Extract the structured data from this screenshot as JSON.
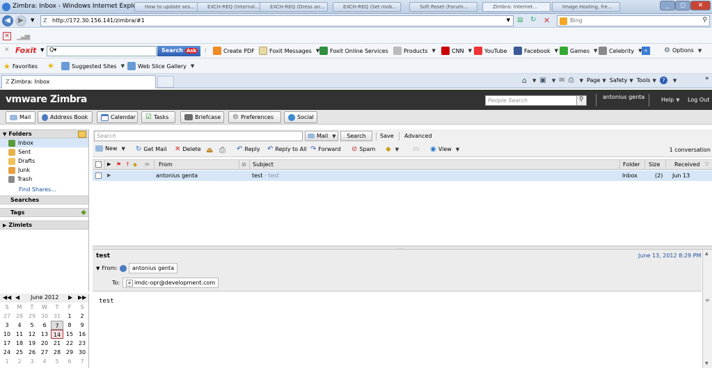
{
  "browser": {
    "window_title": "Zimbra: Inbox - Windows Internet Explorer",
    "taskbar_tabs": [
      "How to update ses...",
      "EXCH-REQ (Internal...",
      "EXCH-REQ (Dress an...",
      "EXCH-REQ (Set mob...",
      "Soft Reset (Forum...",
      "Zimbra: Internet...",
      "Image Hosting, fre..."
    ],
    "url": "http://172.30.156.141/zimbra/#1",
    "search_engine": "Bing",
    "foxit": {
      "brand": "Foxit",
      "search_button": "Search",
      "items": [
        "Create PDF",
        "Foxit Messages",
        "Foxit Online Services",
        "Products",
        "CNN",
        "YouTube",
        "Facebook",
        "Games",
        "Celebrity"
      ],
      "options": "Options"
    },
    "favorites": {
      "label": "Favorites",
      "suggested": "Suggested Sites",
      "webslice": "Web Slice Gallery"
    },
    "tab_title": "Zimbra: Inbox",
    "command_bar": {
      "page": "Page",
      "safety": "Safety",
      "tools": "Tools"
    }
  },
  "zimbra": {
    "logo": "vmware Zimbra",
    "people_search_placeholder": "People Search",
    "user": "antonius genta",
    "help": "Help",
    "logout": "Log Out",
    "apps": [
      "Mail",
      "Address Book",
      "Calendar",
      "Tasks",
      "Briefcase",
      "Preferences",
      "Social"
    ],
    "folders_header": "Folders",
    "folders": [
      "Inbox",
      "Sent",
      "Drafts",
      "Junk",
      "Trash"
    ],
    "find_shares": "Find Shares...",
    "searches": "Searches",
    "tags": "Tags",
    "zimlets": "Zimlets",
    "search": {
      "placeholder": "Search",
      "scope": "Mail",
      "button": "Search",
      "save": "Save",
      "advanced": "Advanced"
    },
    "toolbar": {
      "new": "New",
      "get_mail": "Get Mail",
      "delete": "Delete",
      "reply": "Reply",
      "reply_all": "Reply to All",
      "forward": "Forward",
      "spam": "Spam",
      "view": "View",
      "count": "1 conversation"
    },
    "list_headers": {
      "from": "From",
      "subject": "Subject",
      "folder": "Folder",
      "size": "Size",
      "received": "Received"
    },
    "message": {
      "from": "antonius genta",
      "subject": "test",
      "fragment": " - test",
      "folder": "Inbox",
      "size": "(2)",
      "received": "Jun 13"
    },
    "reading": {
      "subject": "test",
      "date": "June 13, 2012 8:29 PM",
      "from_label": "From:",
      "from": "antonius genta",
      "to_label": "To:",
      "to": "imdc-opr@development.com",
      "body": "test"
    },
    "calendar": {
      "month": "June 2012",
      "weekdays": [
        "S",
        "M",
        "T",
        "W",
        "T",
        "F",
        "S"
      ],
      "weeks": [
        [
          "27",
          "28",
          "29",
          "30",
          "31",
          "1",
          "2"
        ],
        [
          "3",
          "4",
          "5",
          "6",
          "7",
          "8",
          "9"
        ],
        [
          "10",
          "11",
          "12",
          "13",
          "14",
          "15",
          "16"
        ],
        [
          "17",
          "18",
          "19",
          "20",
          "21",
          "22",
          "23"
        ],
        [
          "24",
          "25",
          "26",
          "27",
          "28",
          "29",
          "30"
        ],
        [
          "1",
          "2",
          "3",
          "4",
          "5",
          "6",
          "7"
        ]
      ],
      "today": "14"
    }
  }
}
